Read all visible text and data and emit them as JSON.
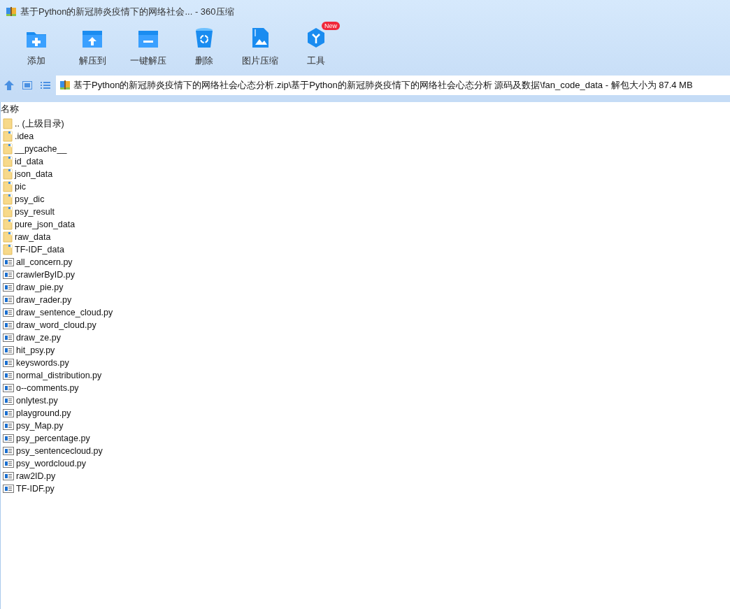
{
  "window": {
    "title": "基于Python的新冠肺炎疫情下的网络社会... - 360压缩"
  },
  "toolbar": [
    {
      "kind": "add",
      "label": "添加"
    },
    {
      "kind": "extract_to",
      "label": "解压到"
    },
    {
      "kind": "extract",
      "label": "一键解压"
    },
    {
      "kind": "delete",
      "label": "删除"
    },
    {
      "kind": "image",
      "label": "图片压缩"
    },
    {
      "kind": "tools",
      "label": "工具",
      "badge": "New"
    }
  ],
  "path_bar": {
    "value": "基于Python的新冠肺炎疫情下的网络社会心态分析.zip\\基于Python的新冠肺炎疫情下的网络社会心态分析 源码及数据\\fan_code_data - 解包大小为 87.4 MB"
  },
  "file_list": {
    "columns": [
      "名称"
    ],
    "rows": [
      {
        "kind": "parent",
        "name": ".. (上级目录)"
      },
      {
        "kind": "folder",
        "name": ".idea"
      },
      {
        "kind": "folder",
        "name": "__pycache__"
      },
      {
        "kind": "folder",
        "name": "id_data"
      },
      {
        "kind": "folder",
        "name": "json_data"
      },
      {
        "kind": "folder",
        "name": "pic"
      },
      {
        "kind": "folder",
        "name": "psy_dic"
      },
      {
        "kind": "folder",
        "name": "psy_result"
      },
      {
        "kind": "folder",
        "name": "pure_json_data"
      },
      {
        "kind": "folder",
        "name": "raw_data"
      },
      {
        "kind": "folder",
        "name": "TF-IDF_data"
      },
      {
        "kind": "file",
        "name": "all_concern.py"
      },
      {
        "kind": "file",
        "name": "crawlerByID.py"
      },
      {
        "kind": "file",
        "name": "draw_pie.py"
      },
      {
        "kind": "file",
        "name": "draw_rader.py"
      },
      {
        "kind": "file",
        "name": "draw_sentence_cloud.py"
      },
      {
        "kind": "file",
        "name": "draw_word_cloud.py"
      },
      {
        "kind": "file",
        "name": "draw_ze.py"
      },
      {
        "kind": "file",
        "name": "hit_psy.py"
      },
      {
        "kind": "file",
        "name": "keyswords.py"
      },
      {
        "kind": "file",
        "name": "normal_distribution.py"
      },
      {
        "kind": "file",
        "name": "o--comments.py"
      },
      {
        "kind": "file",
        "name": "onlytest.py"
      },
      {
        "kind": "file",
        "name": "playground.py"
      },
      {
        "kind": "file",
        "name": "psy_Map.py"
      },
      {
        "kind": "file",
        "name": "psy_percentage.py"
      },
      {
        "kind": "file",
        "name": "psy_sentencecloud.py"
      },
      {
        "kind": "file",
        "name": "psy_wordcloud.py"
      },
      {
        "kind": "file",
        "name": "raw2ID.py"
      },
      {
        "kind": "file",
        "name": "TF-IDF.py"
      }
    ]
  }
}
